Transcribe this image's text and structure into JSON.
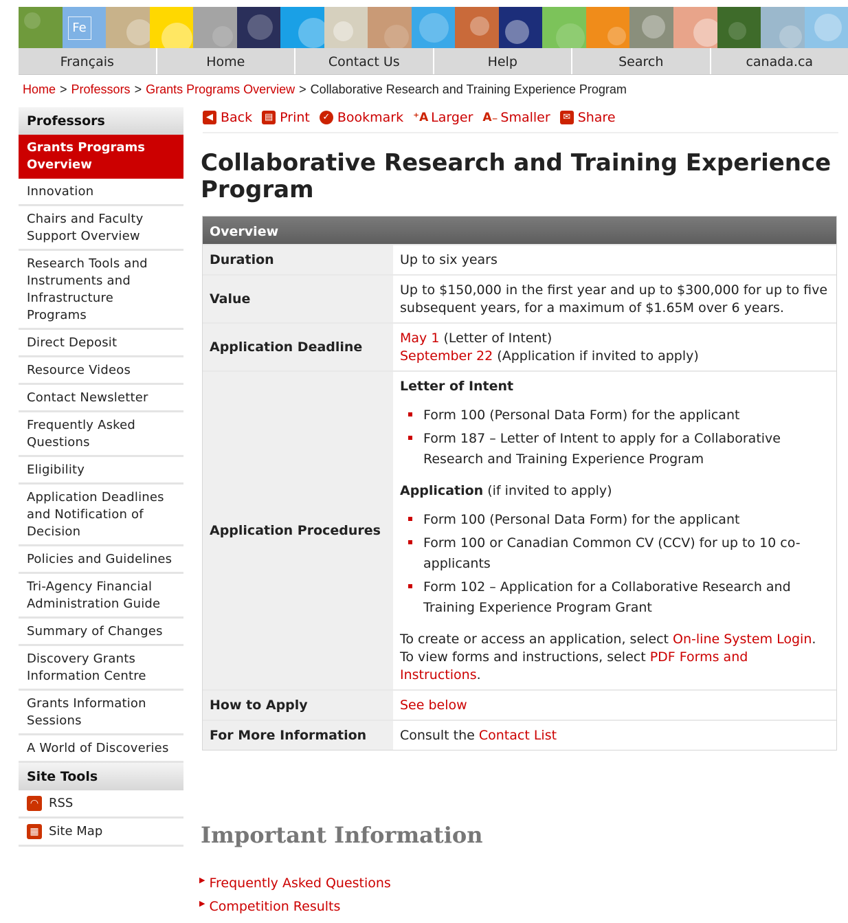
{
  "banner": {
    "tiles": [
      {
        "name": "banner-tile-lettuce",
        "color": "#6f9a3c"
      },
      {
        "name": "banner-tile-iron",
        "color": "#7fb2e5",
        "text": "Fe"
      },
      {
        "name": "banner-tile-eye",
        "color": "#c8b28a"
      },
      {
        "name": "banner-tile-yellow",
        "color": "#ffd800"
      },
      {
        "name": "banner-tile-machine",
        "color": "#a4a4a4"
      },
      {
        "name": "banner-tile-galaxy",
        "color": "#2a2f5a"
      },
      {
        "name": "banner-tile-blue",
        "color": "#1aa0e6"
      },
      {
        "name": "banner-tile-bulb",
        "color": "#d6d0be"
      },
      {
        "name": "banner-tile-ear",
        "color": "#c99a76"
      },
      {
        "name": "banner-tile-exclamation",
        "color": "#3aa8e8"
      },
      {
        "name": "banner-tile-tools",
        "color": "#c96a3a"
      },
      {
        "name": "banner-tile-flame",
        "color": "#1c2e7a"
      },
      {
        "name": "banner-tile-green",
        "color": "#7cc35a"
      },
      {
        "name": "banner-tile-molecule",
        "color": "#f08c1a"
      },
      {
        "name": "banner-tile-rocks",
        "color": "#8a8f7c"
      },
      {
        "name": "banner-tile-smile",
        "color": "#e8a48a"
      },
      {
        "name": "banner-tile-butterfly",
        "color": "#3e6b2a"
      },
      {
        "name": "banner-tile-circuit",
        "color": "#9bb8cc"
      },
      {
        "name": "banner-tile-sky",
        "color": "#8ec4e8"
      }
    ]
  },
  "topnav": {
    "items": [
      "Français",
      "Home",
      "Contact Us",
      "Help",
      "Search",
      "canada.ca"
    ]
  },
  "breadcrumb": {
    "items": [
      "Home",
      "Professors",
      "Grants Programs Overview"
    ],
    "current": "Collaborative Research and Training Experience Program",
    "separator": ">"
  },
  "sidebar": {
    "heading": "Professors",
    "active": "Grants Programs Overview",
    "items": [
      "Innovation",
      "Chairs and Faculty Support Overview",
      "Research Tools and Instruments and Infrastructure Programs",
      "Direct Deposit",
      "Resource Videos",
      "Contact Newsletter",
      "Frequently Asked Questions",
      "Eligibility",
      "Application Deadlines and Notification of Decision",
      "Policies and Guidelines",
      "Tri-Agency Financial Administration Guide",
      "Summary of Changes",
      "Discovery Grants Information Centre",
      "Grants Information Sessions",
      "A World of Discoveries"
    ],
    "tools_heading": "Site Tools",
    "tools": [
      {
        "label": "RSS",
        "icon": "rss-icon"
      },
      {
        "label": "Site Map",
        "icon": "site-map-icon"
      }
    ]
  },
  "toolbar": {
    "back": "Back",
    "print": "Print",
    "bookmark": "Bookmark",
    "larger": "Larger",
    "smaller": "Smaller",
    "share": "Share"
  },
  "page": {
    "title": "Collaborative Research and Training Experience Program"
  },
  "overview": {
    "heading": "Overview",
    "duration_label": "Duration",
    "duration_value": "Up to six years",
    "value_label": "Value",
    "value_value": "Up to $150,000 in the first year and up to $300,000 for up to five subsequent years, for a maximum of $1.65M over 6 years.",
    "deadline_label": "Application Deadline",
    "deadline_1_link": "May 1",
    "deadline_1_text": " (Letter of Intent)",
    "deadline_2_link": "September 22",
    "deadline_2_text": " (Application if invited to apply)",
    "procedures_label": "Application Procedures",
    "loi_title": "Letter of Intent",
    "loi_items": [
      "Form 100 (Personal Data Form) for the applicant",
      "Form 187 – Letter of Intent to apply for a Collaborative Research and Training Experience Program"
    ],
    "app_title": "Application",
    "app_note": " (if invited to apply)",
    "app_items": [
      "Form 100 (Personal Data Form) for the applicant",
      "Form 100 or Canadian Common CV (CCV) for up to 10 co-applicants",
      "Form 102 – Application for a Collaborative Research and Training Experience Program Grant"
    ],
    "access_text_1": "To create or access an application, select ",
    "access_link_1": "On-line System Login",
    "access_text_2": ". To view forms and instructions, select ",
    "access_link_2": "PDF Forms and Instructions",
    "access_text_3": ".",
    "how_label": "How to Apply",
    "how_link": "See below",
    "more_label": "For More Information",
    "more_text": "Consult the ",
    "more_link": "Contact List"
  },
  "important": {
    "heading": "Important Information",
    "links": [
      "Frequently Asked Questions",
      "Competition Results"
    ]
  },
  "colors": {
    "accent_red": "#cc0000",
    "table_header": "#6a6a6a",
    "nav_bg": "#d9d9d9"
  }
}
